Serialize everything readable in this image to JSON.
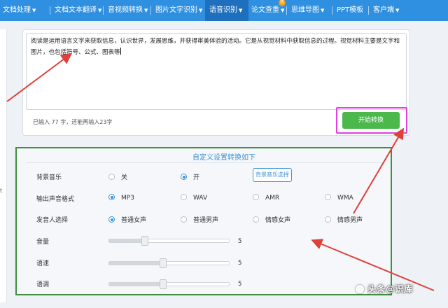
{
  "nav": {
    "items": [
      {
        "label": "文档处理",
        "caret": "▼"
      },
      {
        "label": "文档文本翻译",
        "caret": "▼"
      },
      {
        "label": "音视频转换",
        "caret": "▼"
      },
      {
        "label": "图片文字识别",
        "caret": "▼"
      },
      {
        "label": "语音识别",
        "caret": "▼"
      },
      {
        "label": "论文查重",
        "caret": "▼"
      },
      {
        "label": "思维导图",
        "caret": "▼"
      },
      {
        "label": "PPT模板",
        "caret": ""
      },
      {
        "label": "客户端",
        "caret": "▼"
      }
    ],
    "badge": "热"
  },
  "input": {
    "text": "阅读是运用语言文字来获取信息，认识世界，发展思维，并获得审美体验的活动。它是从视觉材料中获取信息的过程。视觉材料主要是文字和图片，也包括符号、公式、图表等",
    "count_text": "已输入 77 字，还能再输入23字",
    "start_button": "开始转换"
  },
  "settings": {
    "title": "自定义设置转换如下",
    "background_music": {
      "label": "背景音乐",
      "options": [
        "关",
        "开"
      ],
      "selected": "开",
      "select_button": "背景音乐选择"
    },
    "output_format": {
      "label": "输出声音格式",
      "options": [
        "MP3",
        "WAV",
        "AMR",
        "WMA"
      ],
      "selected": "MP3"
    },
    "speaker": {
      "label": "发音人选择",
      "options": [
        "普通女声",
        "普通男声",
        "情感女声",
        "情感男声"
      ],
      "selected": "普通女声"
    },
    "volume": {
      "label": "音量",
      "value": "5",
      "level": 0.3
    },
    "speed": {
      "label": "语速",
      "value": "5",
      "level": 0.45
    },
    "pitch": {
      "label": "语调",
      "value": "5",
      "level": 0.45
    }
  },
  "left_mark": "t",
  "colors": {
    "nav": "#2f8fe0",
    "accent": "#3a93d8",
    "start_button": "#4cb84c",
    "highlight_box": "#e040e0",
    "panel_border": "#3f8f3f",
    "arrow": "#e0403a"
  },
  "watermark": "头条@识库"
}
